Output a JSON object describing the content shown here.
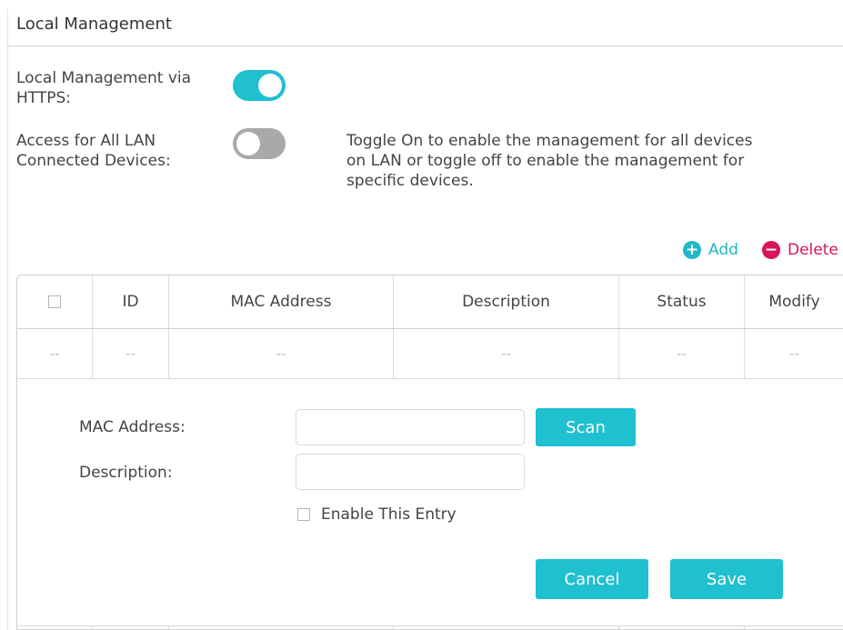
{
  "section": {
    "title": "Local Management"
  },
  "settings": {
    "https": {
      "label_line1": "Local Management via",
      "label_line2": "HTTPS:",
      "enabled": true
    },
    "all_lan": {
      "label_line1": "Access for All LAN",
      "label_line2": "Connected Devices:",
      "enabled": false,
      "hint_line1": "Toggle On to enable the management for all devices",
      "hint_line2": "on LAN or toggle off to enable the management for",
      "hint_line3": "specific devices."
    }
  },
  "table_actions": {
    "add_label": "Add",
    "add_icon": "plus-circle-icon",
    "delete_label": "Delete",
    "delete_icon": "minus-circle-icon",
    "add_color": "#1fb8c6",
    "delete_color": "#d8145b"
  },
  "table": {
    "headers": [
      "ID",
      "MAC Address",
      "Description",
      "Status",
      "Modify"
    ],
    "empty_row": [
      "--",
      "--",
      "--",
      "--",
      "--",
      "--"
    ]
  },
  "edit_form": {
    "mac_label": "MAC Address:",
    "mac_value": "",
    "description_label": "Description:",
    "description_value": "",
    "scan_label": "Scan",
    "enable_label": "Enable This Entry",
    "cancel_label": "Cancel",
    "save_label": "Save"
  },
  "colors": {
    "accent": "#1fc0cf",
    "toggle_off": "#a9a9a9"
  }
}
